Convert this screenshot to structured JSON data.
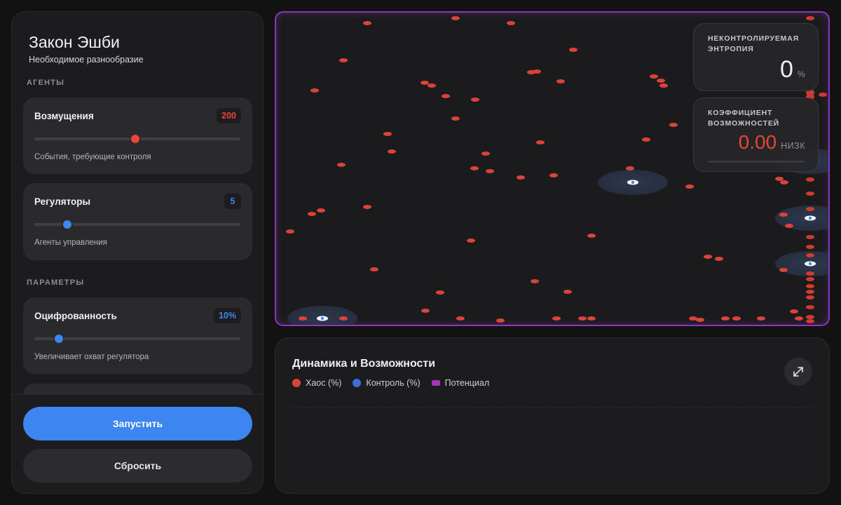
{
  "app": {
    "title": "Закон Эшби",
    "subtitle": "Необходимое разнообразие"
  },
  "sections": {
    "agents": "АГЕНТЫ",
    "params": "ПАРАМЕТРЫ"
  },
  "controls": {
    "disturbances": {
      "label": "Возмущения",
      "value": "200",
      "description": "События, требующие контроля",
      "level": 0.49,
      "color": "#e84438"
    },
    "regulators": {
      "label": "Регуляторы",
      "value": "5",
      "description": "Агенты управления",
      "level": 0.16,
      "color": "#3d86f2"
    },
    "digitization": {
      "label": "Оцифрованность",
      "value": "10%",
      "description": "Увеличивает охват регулятора",
      "level": 0.12,
      "color": "#3d86f2"
    }
  },
  "buttons": {
    "start": "Запустить",
    "reset": "Сбросить"
  },
  "stats": {
    "entropy": {
      "label": "НЕКОНТРОЛИРУЕМАЯ ЭНТРОПИЯ",
      "value": "0",
      "unit": "%"
    },
    "opportunity": {
      "label": "КОЭФФИЦИЕНТ ВОЗМОЖНОСТЕЙ",
      "value": "0.00",
      "level": "НИЗК"
    }
  },
  "chart": {
    "title": "Динамика и Возможности",
    "legend": [
      {
        "label": "Хаос (%)",
        "color": "#d9433a",
        "shape": "dot"
      },
      {
        "label": "Контроль (%)",
        "color": "#3d6fd6",
        "shape": "dot"
      },
      {
        "label": "Потенциал",
        "color": "#a634b8",
        "shape": "square"
      }
    ]
  },
  "colors": {
    "accent": "#3d86f2",
    "chaos": "#e84438",
    "border": "#8b36b7",
    "regulator_zone": "#2a3348"
  },
  "icons": {
    "expand": "expand-arrows-icon"
  }
}
